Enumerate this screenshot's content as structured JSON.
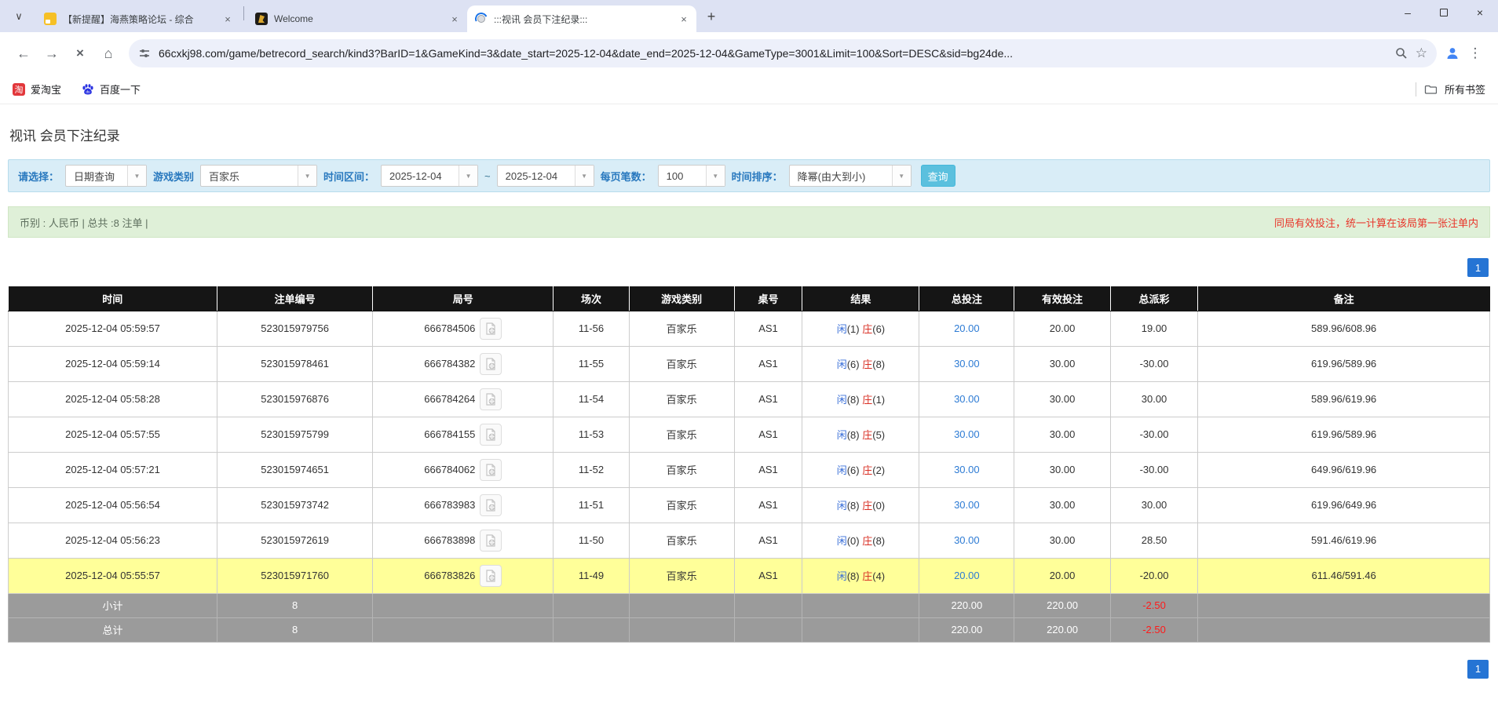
{
  "browser": {
    "tabs": [
      {
        "title": "【新提醒】海燕策略论坛 - 综合",
        "icon": "forum-icon",
        "active": false
      },
      {
        "title": "Welcome",
        "icon": "welcome-icon",
        "active": false
      },
      {
        "title": ":::视讯 会员下注纪录:::",
        "icon": "loading-spinner-icon",
        "active": true
      }
    ],
    "url": "66cxkj98.com/game/betrecord_search/kind3?BarID=1&GameKind=3&date_start=2025-12-04&date_end=2025-12-04&GameType=3001&Limit=100&Sort=DESC&sid=bg24de...",
    "bookmarks": [
      {
        "label": "爱淘宝",
        "icon_char": "淘"
      },
      {
        "label": "百度一下"
      }
    ],
    "all_bookmarks_label": "所有书签"
  },
  "icons": {
    "tab_search_chevron": "∨",
    "tab_close": "×",
    "new_tab_plus": "+",
    "window_minimize": "–",
    "window_close": "×",
    "back": "←",
    "forward": "→",
    "stop": "×",
    "home": "⌂",
    "bookmark_star": "☆",
    "menu_dots": "⋮",
    "dropdown_arrow": "▼"
  },
  "page": {
    "title": "视讯 会员下注纪录",
    "filters": {
      "select_label": "请选择：",
      "select_value": "日期查询",
      "game_kind_label": "游戏类别",
      "game_kind_value": "百家乐",
      "date_range_label": "时间区间：",
      "date_start": "2025-12-04",
      "tilde": "~",
      "date_end": "2025-12-04",
      "per_page_label": "每页笔数：",
      "per_page_value": "100",
      "sort_label": "时间排序：",
      "sort_value": "降幂(由大到小)",
      "search_button": "查询"
    },
    "summary": {
      "left": "币别 : 人民币 | 总共 :8 注单 |",
      "right": "同局有效投注，统一计算在该局第一张注单内"
    },
    "pagination": "1",
    "table": {
      "headers": [
        "时间",
        "注单编号",
        "局号",
        "场次",
        "游戏类别",
        "桌号",
        "结果",
        "总投注",
        "有效投注",
        "总派彩",
        "备注"
      ],
      "rows": [
        {
          "time": "2025-12-04 05:59:57",
          "bet_id": "523015979756",
          "round": "666784506",
          "session": "11-56",
          "game": "百家乐",
          "table_no": "AS1",
          "result_p": "闲(1)",
          "result_b": "庄(6)",
          "total_bet": "20.00",
          "valid_bet": "20.00",
          "payout": "19.00",
          "note": "589.96/608.96",
          "highlight": false
        },
        {
          "time": "2025-12-04 05:59:14",
          "bet_id": "523015978461",
          "round": "666784382",
          "session": "11-55",
          "game": "百家乐",
          "table_no": "AS1",
          "result_p": "闲(6)",
          "result_b": "庄(8)",
          "total_bet": "30.00",
          "valid_bet": "30.00",
          "payout": "-30.00",
          "note": "619.96/589.96",
          "highlight": false
        },
        {
          "time": "2025-12-04 05:58:28",
          "bet_id": "523015976876",
          "round": "666784264",
          "session": "11-54",
          "game": "百家乐",
          "table_no": "AS1",
          "result_p": "闲(8)",
          "result_b": "庄(1)",
          "total_bet": "30.00",
          "valid_bet": "30.00",
          "payout": "30.00",
          "note": "589.96/619.96",
          "highlight": false
        },
        {
          "time": "2025-12-04 05:57:55",
          "bet_id": "523015975799",
          "round": "666784155",
          "session": "11-53",
          "game": "百家乐",
          "table_no": "AS1",
          "result_p": "闲(8)",
          "result_b": "庄(5)",
          "total_bet": "30.00",
          "valid_bet": "30.00",
          "payout": "-30.00",
          "note": "619.96/589.96",
          "highlight": false
        },
        {
          "time": "2025-12-04 05:57:21",
          "bet_id": "523015974651",
          "round": "666784062",
          "session": "11-52",
          "game": "百家乐",
          "table_no": "AS1",
          "result_p": "闲(6)",
          "result_b": "庄(2)",
          "total_bet": "30.00",
          "valid_bet": "30.00",
          "payout": "-30.00",
          "note": "649.96/619.96",
          "highlight": false
        },
        {
          "time": "2025-12-04 05:56:54",
          "bet_id": "523015973742",
          "round": "666783983",
          "session": "11-51",
          "game": "百家乐",
          "table_no": "AS1",
          "result_p": "闲(8)",
          "result_b": "庄(0)",
          "total_bet": "30.00",
          "valid_bet": "30.00",
          "payout": "30.00",
          "note": "619.96/649.96",
          "highlight": false
        },
        {
          "time": "2025-12-04 05:56:23",
          "bet_id": "523015972619",
          "round": "666783898",
          "session": "11-50",
          "game": "百家乐",
          "table_no": "AS1",
          "result_p": "闲(0)",
          "result_b": "庄(8)",
          "total_bet": "30.00",
          "valid_bet": "30.00",
          "payout": "28.50",
          "note": "591.46/619.96",
          "highlight": false
        },
        {
          "time": "2025-12-04 05:55:57",
          "bet_id": "523015971760",
          "round": "666783826",
          "session": "11-49",
          "game": "百家乐",
          "table_no": "AS1",
          "result_p": "闲(8)",
          "result_b": "庄(4)",
          "total_bet": "20.00",
          "valid_bet": "20.00",
          "payout": "-20.00",
          "note": "611.46/591.46",
          "highlight": true
        }
      ],
      "subtotal": {
        "label": "小计",
        "count": "8",
        "total_bet": "220.00",
        "valid_bet": "220.00",
        "payout": "-2.50"
      },
      "total": {
        "label": "总计",
        "count": "8",
        "total_bet": "220.00",
        "valid_bet": "220.00",
        "payout": "-2.50"
      }
    }
  },
  "colors": {
    "accent_blue": "#2574d4",
    "link_blue": "#2d7bd4",
    "player_blue": "#3a6fd8",
    "banker_red": "#d93025",
    "negative_red": "#e60000",
    "highlight_yellow": "#ffff99",
    "totals_gray": "#9b9b9b",
    "header_black": "#151515",
    "search_button_teal": "#5bc0de",
    "filter_bar_bg": "#d9edf7",
    "summary_bar_bg": "#dff0d8",
    "warning_red": "#e8352a"
  }
}
